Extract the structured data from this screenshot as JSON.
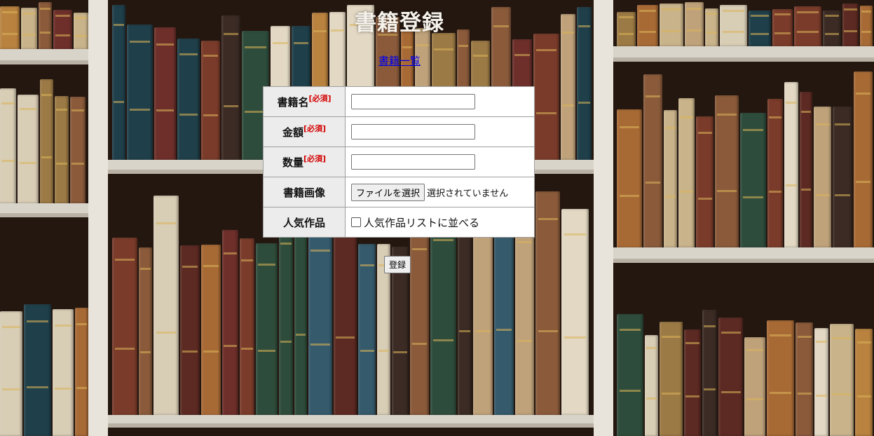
{
  "page": {
    "title": "書籍登録",
    "list_link": "書籍一覧"
  },
  "form": {
    "required_mark": "[必須]",
    "fields": [
      {
        "label": "書籍名",
        "required": true,
        "type": "text",
        "value": ""
      },
      {
        "label": "金額",
        "required": true,
        "type": "text",
        "value": ""
      },
      {
        "label": "数量",
        "required": true,
        "type": "text",
        "value": ""
      },
      {
        "label": "書籍画像",
        "required": false,
        "type": "file",
        "button_label": "ファイルを選択",
        "status": "選択されていません"
      },
      {
        "label": "人気作品",
        "required": false,
        "type": "checkbox",
        "checkbox_label": "人気作品リストに並べる",
        "checked": false
      }
    ],
    "submit_label": "登録"
  },
  "colors": {
    "title": "#f5f2ec",
    "link": "#0000ee",
    "required": "#d40000",
    "header_cell": "#ececec"
  }
}
